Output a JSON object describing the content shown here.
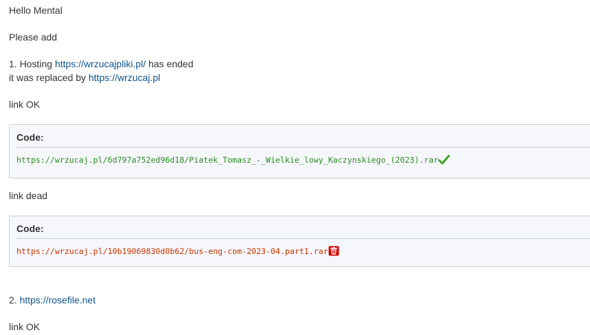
{
  "post": {
    "greeting": "Hello Mental",
    "request": "Please add",
    "item1": {
      "prefix": "1. Hosting ",
      "old_url": "https://wrzucajpliki.pl/",
      "suffix": " has ended",
      "replaced_text": "it was replaced by ",
      "new_url": "https://wrzucaj.pl"
    },
    "link_ok_1": "link OK",
    "code_ok": {
      "title": "Code:",
      "content": "https://wrzucaj.pl/6d797a752ed96d18/Piatek_Tomasz_-_Wielkie_lowy_Kaczynskiego_(2023).rar",
      "status_icon": "checkmark-icon",
      "color": "#2e8b24"
    },
    "link_dead": "link dead",
    "code_dead": {
      "title": "Code:",
      "content": "https://wrzucaj.pl/10b19069830d0b62/bus-eng-com-2023-04.part1.rar",
      "status_icon": "trash-icon",
      "color": "#cc3300"
    },
    "item2": {
      "prefix": "2. ",
      "url": "https://rosefile.net"
    },
    "link_ok_2": "link OK"
  },
  "colors": {
    "link": "#105289",
    "text": "#333333",
    "codebox_border": "#c9d2d8"
  }
}
